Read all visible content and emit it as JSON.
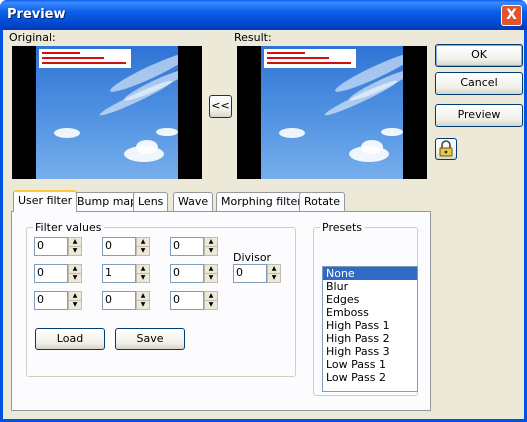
{
  "window": {
    "title": "Preview",
    "close_label": "X"
  },
  "labels": {
    "original": "Original:",
    "result": "Result:"
  },
  "buttons": {
    "copy": "<<",
    "ok": "OK",
    "cancel": "Cancel",
    "preview": "Preview",
    "lock": "lock-icon"
  },
  "tabs": [
    "User filter",
    "Bump map",
    "Lens",
    "Wave",
    "Morphing filters",
    "Rotate"
  ],
  "filter_values": {
    "title": "Filter values",
    "grid": [
      [
        "0",
        "0",
        "0"
      ],
      [
        "0",
        "1",
        "0"
      ],
      [
        "0",
        "0",
        "0"
      ]
    ],
    "divisor_label": "Divisor",
    "divisor": "0"
  },
  "actions": {
    "load": "Load",
    "save": "Save"
  },
  "presets": {
    "title": "Presets",
    "items": [
      "None",
      "Blur",
      "Edges",
      "Emboss",
      "High Pass 1",
      "High Pass 2",
      "High Pass 3",
      "Low Pass 1",
      "Low Pass 2"
    ],
    "selected": "None"
  },
  "colors": {
    "titlebar": "#0054e3",
    "selection": "#316ac5",
    "face": "#ece9d8"
  }
}
